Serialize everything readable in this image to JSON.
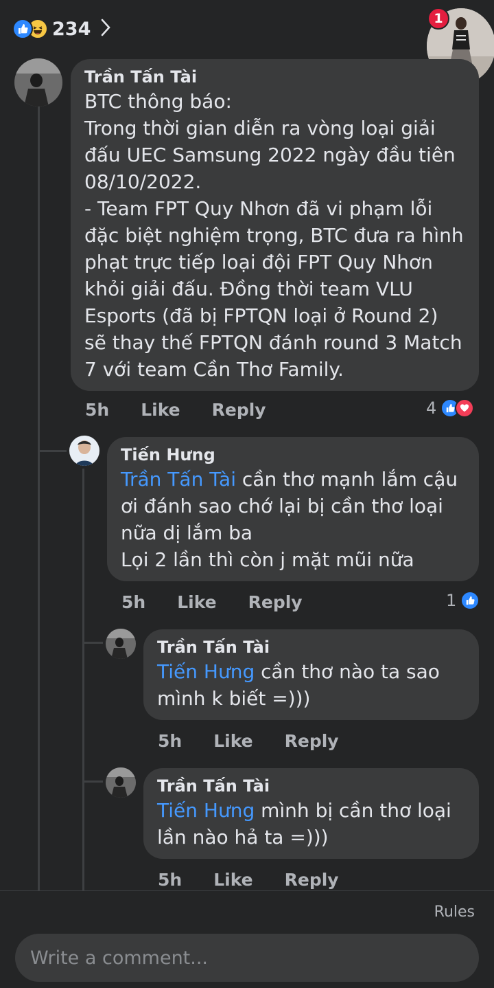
{
  "top": {
    "reaction_count": "234"
  },
  "notification": {
    "badge_count": "1"
  },
  "comments": [
    {
      "author": "Trần Tấn Tài",
      "mention": "",
      "text": "BTC thông báo:\nTrong thời gian diễn ra vòng loại giải đấu UEC Samsung 2022 ngày đầu tiên 08/10/2022.\n- Team FPT Quy Nhơn đã vi phạm lỗi đặc biệt nghiệm trọng, BTC đưa ra hình phạt trực tiếp loại đội FPT Quy Nhơn khỏi giải đấu. Đồng thời team VLU Esports (đã bị FPTQN loại ở Round 2) sẽ thay thế FPTQN đánh round 3 Match 7 với team Cần Thơ Family.",
      "time": "5h",
      "like": "Like",
      "reply": "Reply",
      "reactions": "4"
    },
    {
      "author": "Tiến Hưng",
      "mention": "Trần Tấn Tài",
      "text": " cần thơ mạnh lắm cậu ơi đánh sao chớ lại bị cần thơ loại nữa dị lắm ba\nLọi 2 lần thì còn j mặt mũi nữa",
      "time": "5h",
      "like": "Like",
      "reply": "Reply",
      "reactions": "1"
    },
    {
      "author": "Trần Tấn Tài",
      "mention": "Tiến Hưng",
      "text": " cần thơ nào ta sao mình k biết =)))",
      "time": "5h",
      "like": "Like",
      "reply": "Reply",
      "reactions": ""
    },
    {
      "author": "Trần Tấn Tài",
      "mention": "Tiến Hưng",
      "text": " mình bị cần thơ loại lần nào hả ta =)))",
      "time": "5h",
      "like": "Like",
      "reply": "Reply",
      "reactions": ""
    }
  ],
  "composer": {
    "rules_label": "Rules",
    "placeholder": "Write a comment..."
  },
  "colors": {
    "background": "#242526",
    "bubble": "#3a3b3c",
    "mention": "#4599ff",
    "like_blue": "#2d88ff",
    "love_red": "#f33e58",
    "badge_red": "#e41e3f"
  },
  "icons": [
    "like-icon",
    "haha-icon",
    "chevron-right-icon",
    "love-icon"
  ]
}
